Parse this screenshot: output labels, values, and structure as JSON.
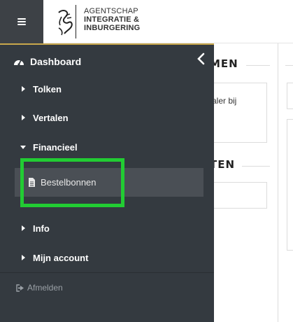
{
  "header": {
    "logo_line1": "AGENTSCHAP",
    "logo_line2": "INTEGRATIE &",
    "logo_line3": "INBURGERING",
    "menu_icon": "hamburger-icon"
  },
  "background": {
    "section1_title": "MEN",
    "section1_text": "aler bij",
    "section2_title": "TEN"
  },
  "sidebar": {
    "dashboard_label": "Dashboard",
    "items": [
      {
        "label": "Tolken",
        "expanded": false
      },
      {
        "label": "Vertalen",
        "expanded": false
      },
      {
        "label": "Financieel",
        "expanded": true
      },
      {
        "label": "Info",
        "expanded": false
      },
      {
        "label": "Mijn account",
        "expanded": false
      }
    ],
    "sub_items": [
      {
        "label": "Bestelbonnen",
        "icon": "document-icon"
      }
    ],
    "logout_label": "Afmelden",
    "colors": {
      "bg": "#343a40",
      "accent": "#c9a84c",
      "highlight": "#22cc33"
    }
  }
}
